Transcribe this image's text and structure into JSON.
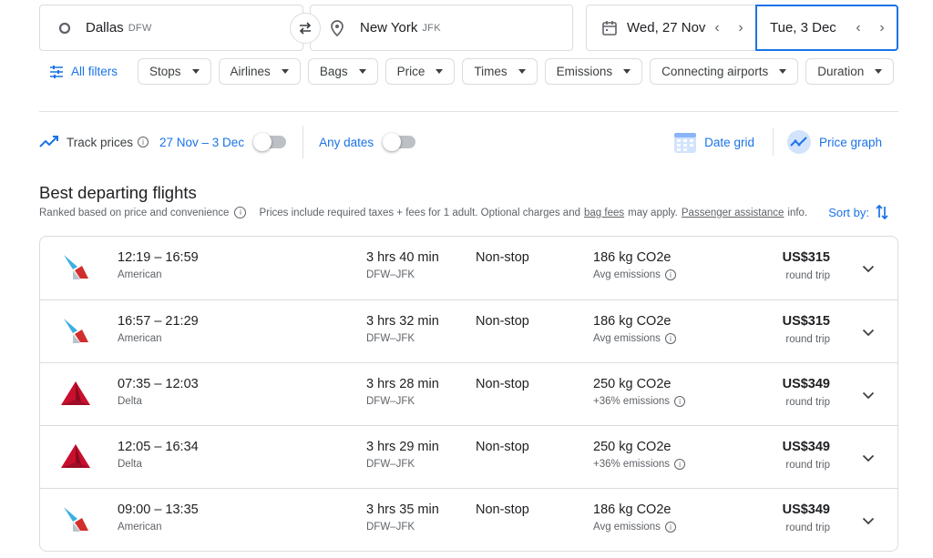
{
  "search": {
    "origin": {
      "city": "Dallas",
      "code": "DFW"
    },
    "destination": {
      "city": "New York",
      "code": "JFK"
    },
    "depart_date": "Wed, 27 Nov",
    "return_date": "Tue, 3 Dec"
  },
  "filters": {
    "all_filters_label": "All filters",
    "chips": [
      "Stops",
      "Airlines",
      "Bags",
      "Price",
      "Times",
      "Emissions",
      "Connecting airports",
      "Duration"
    ]
  },
  "tracking": {
    "track_label": "Track prices",
    "date_range": "27 Nov – 3 Dec",
    "any_dates_label": "Any dates",
    "date_grid_label": "Date grid",
    "price_graph_label": "Price graph"
  },
  "results": {
    "title": "Best departing flights",
    "ranked_text": "Ranked based on price and convenience",
    "prices_text": "Prices include required taxes + fees for 1 adult. Optional charges and",
    "bag_fees_link": "bag fees",
    "may_apply_text": "may apply.",
    "assistance_link": "Passenger assistance",
    "info_text": "info.",
    "sort_label": "Sort by:",
    "flights": [
      {
        "airline": "American",
        "logo": "american",
        "times": "12:19 – 16:59",
        "duration": "3 hrs 40 min",
        "route": "DFW–JFK",
        "stops": "Non-stop",
        "co2": "186 kg CO2e",
        "emissions": "Avg emissions",
        "price": "US$315",
        "trip": "round trip"
      },
      {
        "airline": "American",
        "logo": "american",
        "times": "16:57 – 21:29",
        "duration": "3 hrs 32 min",
        "route": "DFW–JFK",
        "stops": "Non-stop",
        "co2": "186 kg CO2e",
        "emissions": "Avg emissions",
        "price": "US$315",
        "trip": "round trip"
      },
      {
        "airline": "Delta",
        "logo": "delta",
        "times": "07:35 – 12:03",
        "duration": "3 hrs 28 min",
        "route": "DFW–JFK",
        "stops": "Non-stop",
        "co2": "250 kg CO2e",
        "emissions": "+36% emissions",
        "price": "US$349",
        "trip": "round trip"
      },
      {
        "airline": "Delta",
        "logo": "delta",
        "times": "12:05 – 16:34",
        "duration": "3 hrs 29 min",
        "route": "DFW–JFK",
        "stops": "Non-stop",
        "co2": "250 kg CO2e",
        "emissions": "+36% emissions",
        "price": "US$349",
        "trip": "round trip"
      },
      {
        "airline": "American",
        "logo": "american",
        "times": "09:00 – 13:35",
        "duration": "3 hrs 35 min",
        "route": "DFW–JFK",
        "stops": "Non-stop",
        "co2": "186 kg CO2e",
        "emissions": "Avg emissions",
        "price": "US$349",
        "trip": "round trip"
      }
    ]
  },
  "colors": {
    "accent": "#1a73e8",
    "american_red": "#d12e2e",
    "american_blue": "#3ab0e2",
    "delta_red": "#c8102e"
  }
}
